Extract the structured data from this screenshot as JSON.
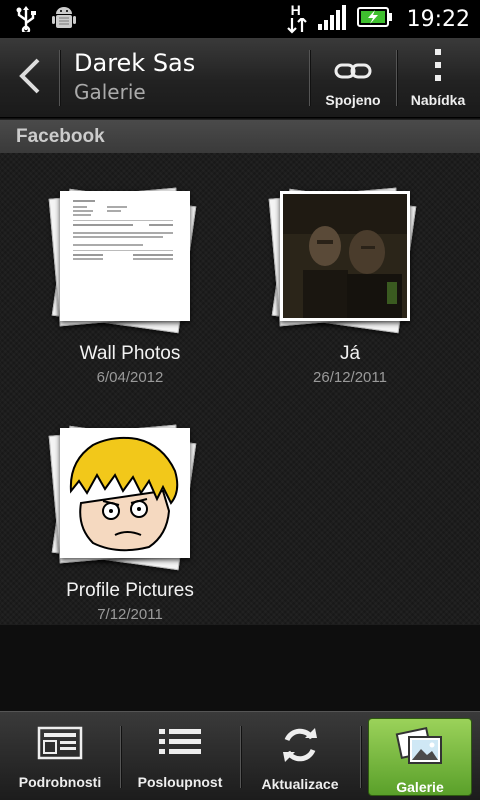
{
  "status_bar": {
    "time": "19:22",
    "network": "H",
    "icons": [
      "usb-icon",
      "android-debug-icon",
      "network-h-icon",
      "signal-icon",
      "battery-charging-icon"
    ]
  },
  "action_bar": {
    "title": "Darek Sas",
    "subtitle": "Galerie",
    "actions": [
      {
        "label": "Spojeno",
        "icon": "link-icon"
      },
      {
        "label": "Nabídka",
        "icon": "menu-dots-icon"
      }
    ]
  },
  "section": {
    "title": "Facebook"
  },
  "albums": [
    {
      "name": "Wall Photos",
      "date": "6/04/2012",
      "thumb": "document-thumbnail"
    },
    {
      "name": "Já",
      "date": "26/12/2011",
      "thumb": "dark-photo-thumbnail"
    },
    {
      "name": "Profile Pictures",
      "date": "7/12/2011",
      "thumb": "cartoon-face-thumbnail"
    }
  ],
  "bottom_tabs": [
    {
      "label": "Podrobnosti",
      "icon": "details-icon",
      "active": false
    },
    {
      "label": "Posloupnost",
      "icon": "list-icon",
      "active": false
    },
    {
      "label": "Aktualizace",
      "icon": "refresh-icon",
      "active": false
    },
    {
      "label": "Galerie",
      "icon": "gallery-icon",
      "active": true
    }
  ],
  "colors": {
    "accent": "#7cc242",
    "background": "#181818",
    "section_header": "#444444"
  }
}
